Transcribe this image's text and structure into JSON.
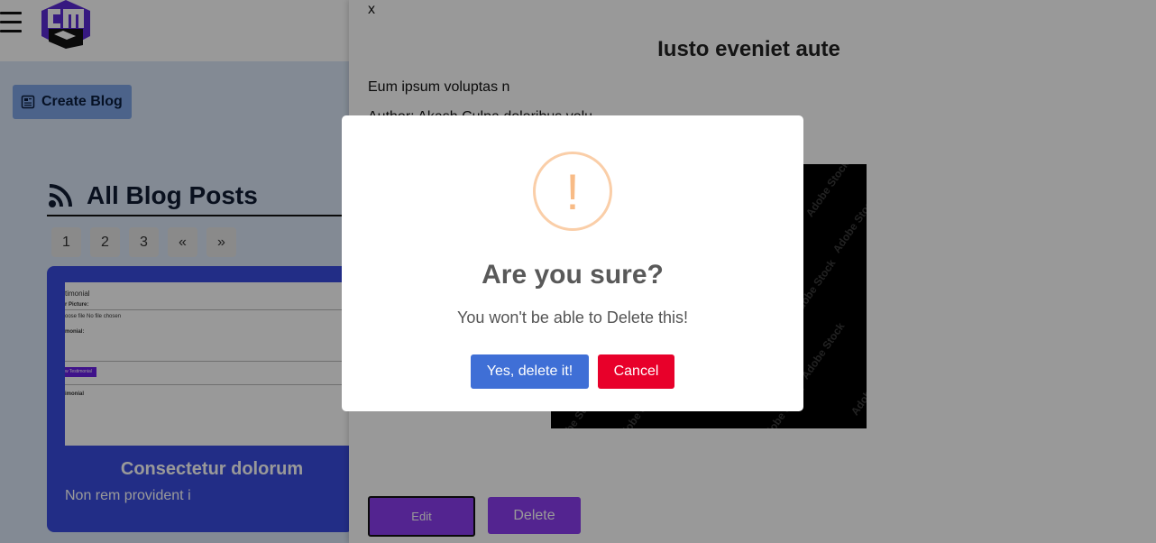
{
  "header": {
    "menu_icon": "hamburger-icon",
    "logo_text": "CMS"
  },
  "sidebar": {
    "create_blog_label": "Create Blog",
    "create_blog_icon": "blog-form-icon"
  },
  "blog_list": {
    "title": "All Blog Posts",
    "title_icon": "rss-icon",
    "pagination": [
      "1",
      "2",
      "3",
      "«",
      "»"
    ],
    "card": {
      "title": "Consectetur dolorum",
      "description": "Non rem provident i",
      "thumbnail_texts": {
        "line1": "timonial",
        "line2": "r Picture:",
        "line3": "oose file  No file chosen",
        "line4": "monial:",
        "button": "w Testimonial",
        "line5": "imonial"
      }
    }
  },
  "detail_panel": {
    "close_label": "x",
    "title": "Iusto eveniet aute",
    "body": "Eum ipsum voluptas n",
    "author": "Author: Akash Culpa doloribus volu",
    "image_watermark": "Adobe Stock",
    "edit_label": "Edit",
    "delete_label": "Delete"
  },
  "dialog": {
    "icon_glyph": "!",
    "title": "Are you sure?",
    "text": "You won't be able to Delete this!",
    "confirm_label": "Yes, delete it!",
    "cancel_label": "Cancel"
  },
  "colors": {
    "accent_blue": "#3f6fd6",
    "danger_red": "#e8002a",
    "purple": "#8a3cf0",
    "warning": "#f8bb86"
  }
}
